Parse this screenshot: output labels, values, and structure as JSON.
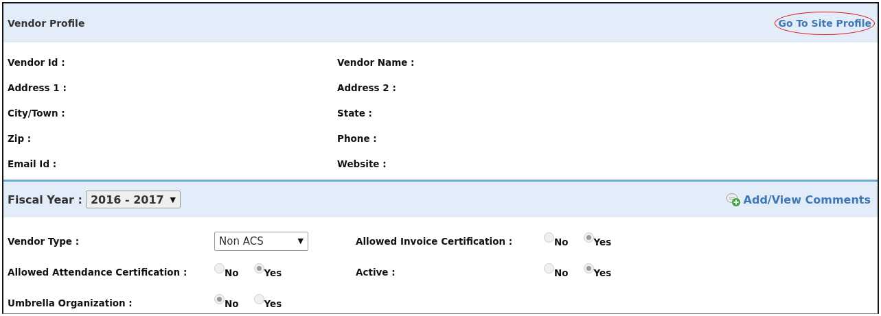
{
  "header": {
    "title": "Vendor Profile",
    "link": "Go To Site Profile"
  },
  "details": [
    {
      "left": "Vendor Id :",
      "right": "Vendor Name :"
    },
    {
      "left": "Address 1 :",
      "right": "Address 2 :"
    },
    {
      "left": "City/Town :",
      "right": "State :"
    },
    {
      "left": "Zip :",
      "right": "Phone :"
    },
    {
      "left": "Email Id :",
      "right": "Website :"
    }
  ],
  "fiscal": {
    "label": "Fiscal Year :",
    "value": "2016 - 2017",
    "arrow": "▼",
    "comments_link": "Add/View Comments"
  },
  "fields": [
    {
      "label": "Vendor Type :",
      "kind": "select",
      "value": "Non ACS",
      "arrow": "▼"
    },
    {
      "label": "Allowed Invoice Certification :",
      "kind": "radio",
      "options": [
        {
          "label": "No",
          "selected": false
        },
        {
          "label": "Yes",
          "selected": true
        }
      ]
    },
    {
      "label": "Allowed Attendance Certification :",
      "kind": "radio",
      "options": [
        {
          "label": "No",
          "selected": false
        },
        {
          "label": "Yes",
          "selected": true
        }
      ]
    },
    {
      "label": "Active :",
      "kind": "radio",
      "options": [
        {
          "label": "No",
          "selected": false
        },
        {
          "label": "Yes",
          "selected": true
        }
      ]
    },
    {
      "label": "Umbrella Organization :",
      "kind": "radio",
      "options": [
        {
          "label": "No",
          "selected": true
        },
        {
          "label": "Yes",
          "selected": false
        }
      ]
    }
  ]
}
